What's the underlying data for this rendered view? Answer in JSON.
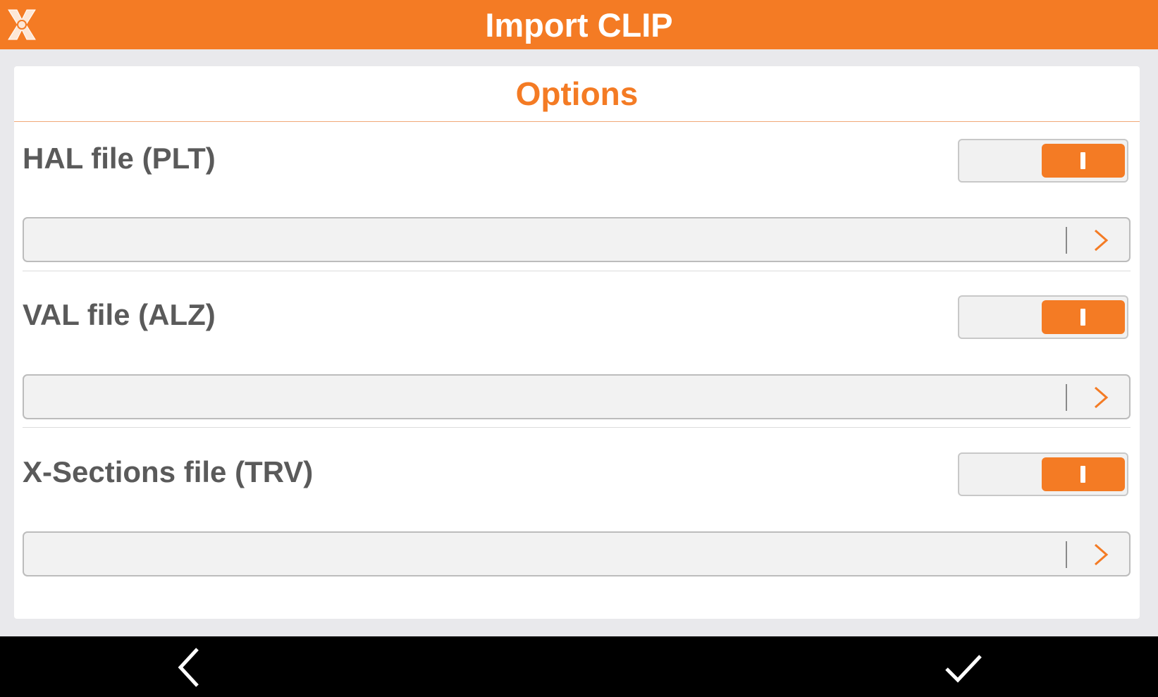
{
  "header": {
    "title": "Import CLIP",
    "logo_icon": "x-survey-logo-icon",
    "color": "#f47b24"
  },
  "options": {
    "title": "Options",
    "rows": [
      {
        "label": "HAL file (PLT)",
        "enabled": true,
        "value": ""
      },
      {
        "label": "VAL file (ALZ)",
        "enabled": true,
        "value": ""
      },
      {
        "label": "X-Sections file (TRV)",
        "enabled": true,
        "value": ""
      }
    ]
  },
  "navbar": {
    "back_icon": "back-chevron-icon",
    "confirm_icon": "checkmark-icon"
  },
  "colors": {
    "accent": "#f47b24",
    "background": "#e9e9ec",
    "navbar": "#000000"
  }
}
